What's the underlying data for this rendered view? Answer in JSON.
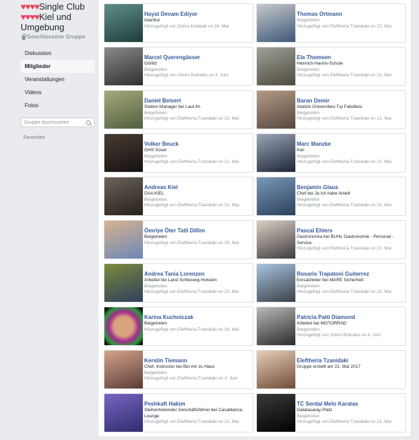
{
  "group": {
    "title_hearts1": "♥♥♥♥",
    "title_part1": "Single Club ",
    "title_hearts2": "♥♥♥♥",
    "title_part2": "Kiel und Umgebung",
    "subtitle": "Geschlossene Gruppe"
  },
  "nav": {
    "items": [
      {
        "label": "Diskussion"
      },
      {
        "label": "Mitglieder"
      },
      {
        "label": "Veranstaltungen"
      },
      {
        "label": "Videos"
      },
      {
        "label": "Fotos"
      }
    ]
  },
  "search": {
    "placeholder": "Gruppe durchsuchen",
    "icon": "search-icon"
  },
  "favorites_label": "Favoriten",
  "members": [
    {
      "name": "Hayat Devam Ediyor",
      "line1": "istanbul",
      "line2": "",
      "line3": "Hinzugefügt von Zehra Kodalak on 26. Mai"
    },
    {
      "name": "Thomas Ortmann",
      "line1": "",
      "line2": "Beigetreten",
      "line3": "Hinzugefügt von Eleftheria Tzanidaki on 22. Mai"
    },
    {
      "name": "Marcel Querengässer",
      "line1": "Görlitz",
      "line2": "Beigetreten",
      "line3": "Hinzugefügt von Sören Brandes on 3. Juni"
    },
    {
      "name": "Ela Thomsen",
      "line1": "Heinrich-Harms-Schule",
      "line2": "Beigetreten",
      "line3": "Hinzugefügt von Eleftheria Tzanidaki on 22. Mai"
    },
    {
      "name": "Daniel Beisert",
      "line1": "Station Manager bei Laut.fm",
      "line2": "Beigetreten",
      "line3": "Hinzugefügt von Eleftheria Tzanidaki on 23. Mai"
    },
    {
      "name": "Baran Demir",
      "line1": "Atatürk Üniversitesi Tıp Fakültesi",
      "line2": "Beigetreten",
      "line3": "Hinzugefügt von Eleftheria Tzanidaki on 21. Mai"
    },
    {
      "name": "Volker Beuck",
      "line1": "GHS Süsel",
      "line2": "Beigetreten",
      "line3": "Hinzugefügt von Eleftheria Tzanidaki on 21. Mai"
    },
    {
      "name": "Marc Manzke",
      "line1": "Kiel",
      "line2": "Beigetreten",
      "line3": "Hinzugefügt von Eleftheria Tzanidaki on 21. Mai"
    },
    {
      "name": "Andreas Kiel",
      "line1": "DAA KIEL",
      "line2": "Beigetreten",
      "line3": "Hinzugefügt von Eleftheria Tzanidaki on 21. Mai"
    },
    {
      "name": "Benjamin Glaus",
      "line1": "Chef bei Ja ich habe Arbeit",
      "line2": "Beigetreten",
      "line3": "Hinzugefügt von Eleftheria Tzanidaki on 22. Mai"
    },
    {
      "name": "Ömriye Öter Tatli Dillim",
      "line1": "Beigetreten",
      "line2": "",
      "line3": "Hinzugefügt von Eleftheria Tzanidaki on 25. Mai"
    },
    {
      "name": "Pascal Ehlers",
      "line1": "Gastronomia bei BUHL Gastronomie - Personal - Service",
      "line2": "",
      "line3": "Hinzugefügt von Eleftheria Tzanidaki on 21. Mai"
    },
    {
      "name": "Andrea Tania Lorenzen",
      "line1": "Arbeitet bei Land Schleswig-Holstein",
      "line2": "Beigetreten",
      "line3": "Hinzugefügt von Eleftheria Tzanidaki on 23. Mai"
    },
    {
      "name": "Rosario Trapatoni Guiterrez",
      "line1": "Einsatzleiter bei MARE Sicherheit",
      "line2": "Beigetreten",
      "line3": "Hinzugefügt von Eleftheria Tzanidaki on 22. Mai"
    },
    {
      "name": "Karina Kuchniczak",
      "line1": "Beigetreten",
      "line2": "",
      "line3": "Hinzugefügt von Eleftheria Tzanidaki on 26. Mai"
    },
    {
      "name": "Patricia Patti Diamond",
      "line1": "Arbeitet bei MOTORRAD",
      "line2": "Beigetreten",
      "line3": "Hinzugefügt von Sören Brandes on 4. Juni"
    },
    {
      "name": "Kerstin Tiemann",
      "line1": "Chef, Instructor bei Bei mir zu Haus",
      "line2": "Beigetreten",
      "line3": "Hinzugefügt von Eleftheria Tzanidaki on 2. Juni"
    },
    {
      "name": "Eleftheria Tzanidaki",
      "line1": "Gruppe erstellt am 21. Mai 2017",
      "line2": "",
      "line3": ""
    },
    {
      "name": "Peshkaft Hakim",
      "line1": "Stellvertretender Geschäftsführer bei Casablanca-Lounge",
      "line2": "",
      "line3": "Hinzugefügt von Eleftheria Tzanidaki on 21. Mai"
    },
    {
      "name": "TC Serdal Melo Karatas",
      "line1": "Galatasaray-Platz",
      "line2": "Beigetreten",
      "line3": "Hinzugefügt von Eleftheria Tzanidaki on 21. Mai"
    }
  ]
}
